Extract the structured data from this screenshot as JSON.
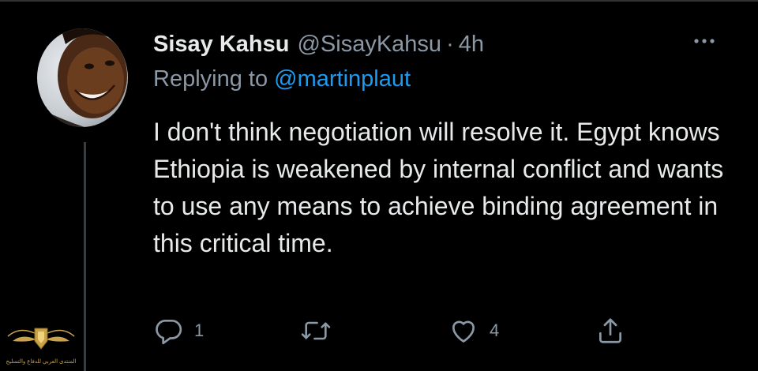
{
  "tweet": {
    "author_name": "Sisay Kahsu",
    "author_handle": "@SisayKahsu",
    "separator": "·",
    "timestamp": "4h",
    "replying_prefix": "Replying to",
    "replying_handle": "@martinplaut",
    "text": "I don't think negotiation will resolve it. Egypt knows Ethiopia is weakened by internal conflict and wants to use any means to achieve binding agreement in this critical time."
  },
  "actions": {
    "reply_icon": "reply-icon",
    "reply_count": "1",
    "retweet_icon": "retweet-icon",
    "retweet_count": "",
    "like_icon": "heart-icon",
    "like_count": "4",
    "share_icon": "share-icon"
  },
  "watermark": {
    "text": "المنتدى العربي للدفاع والتسليح"
  },
  "colors": {
    "background": "#000000",
    "primary_text": "#e7e9ea",
    "secondary_text": "#8b98a5",
    "link": "#1d9bf0",
    "divider": "#2f3336"
  }
}
